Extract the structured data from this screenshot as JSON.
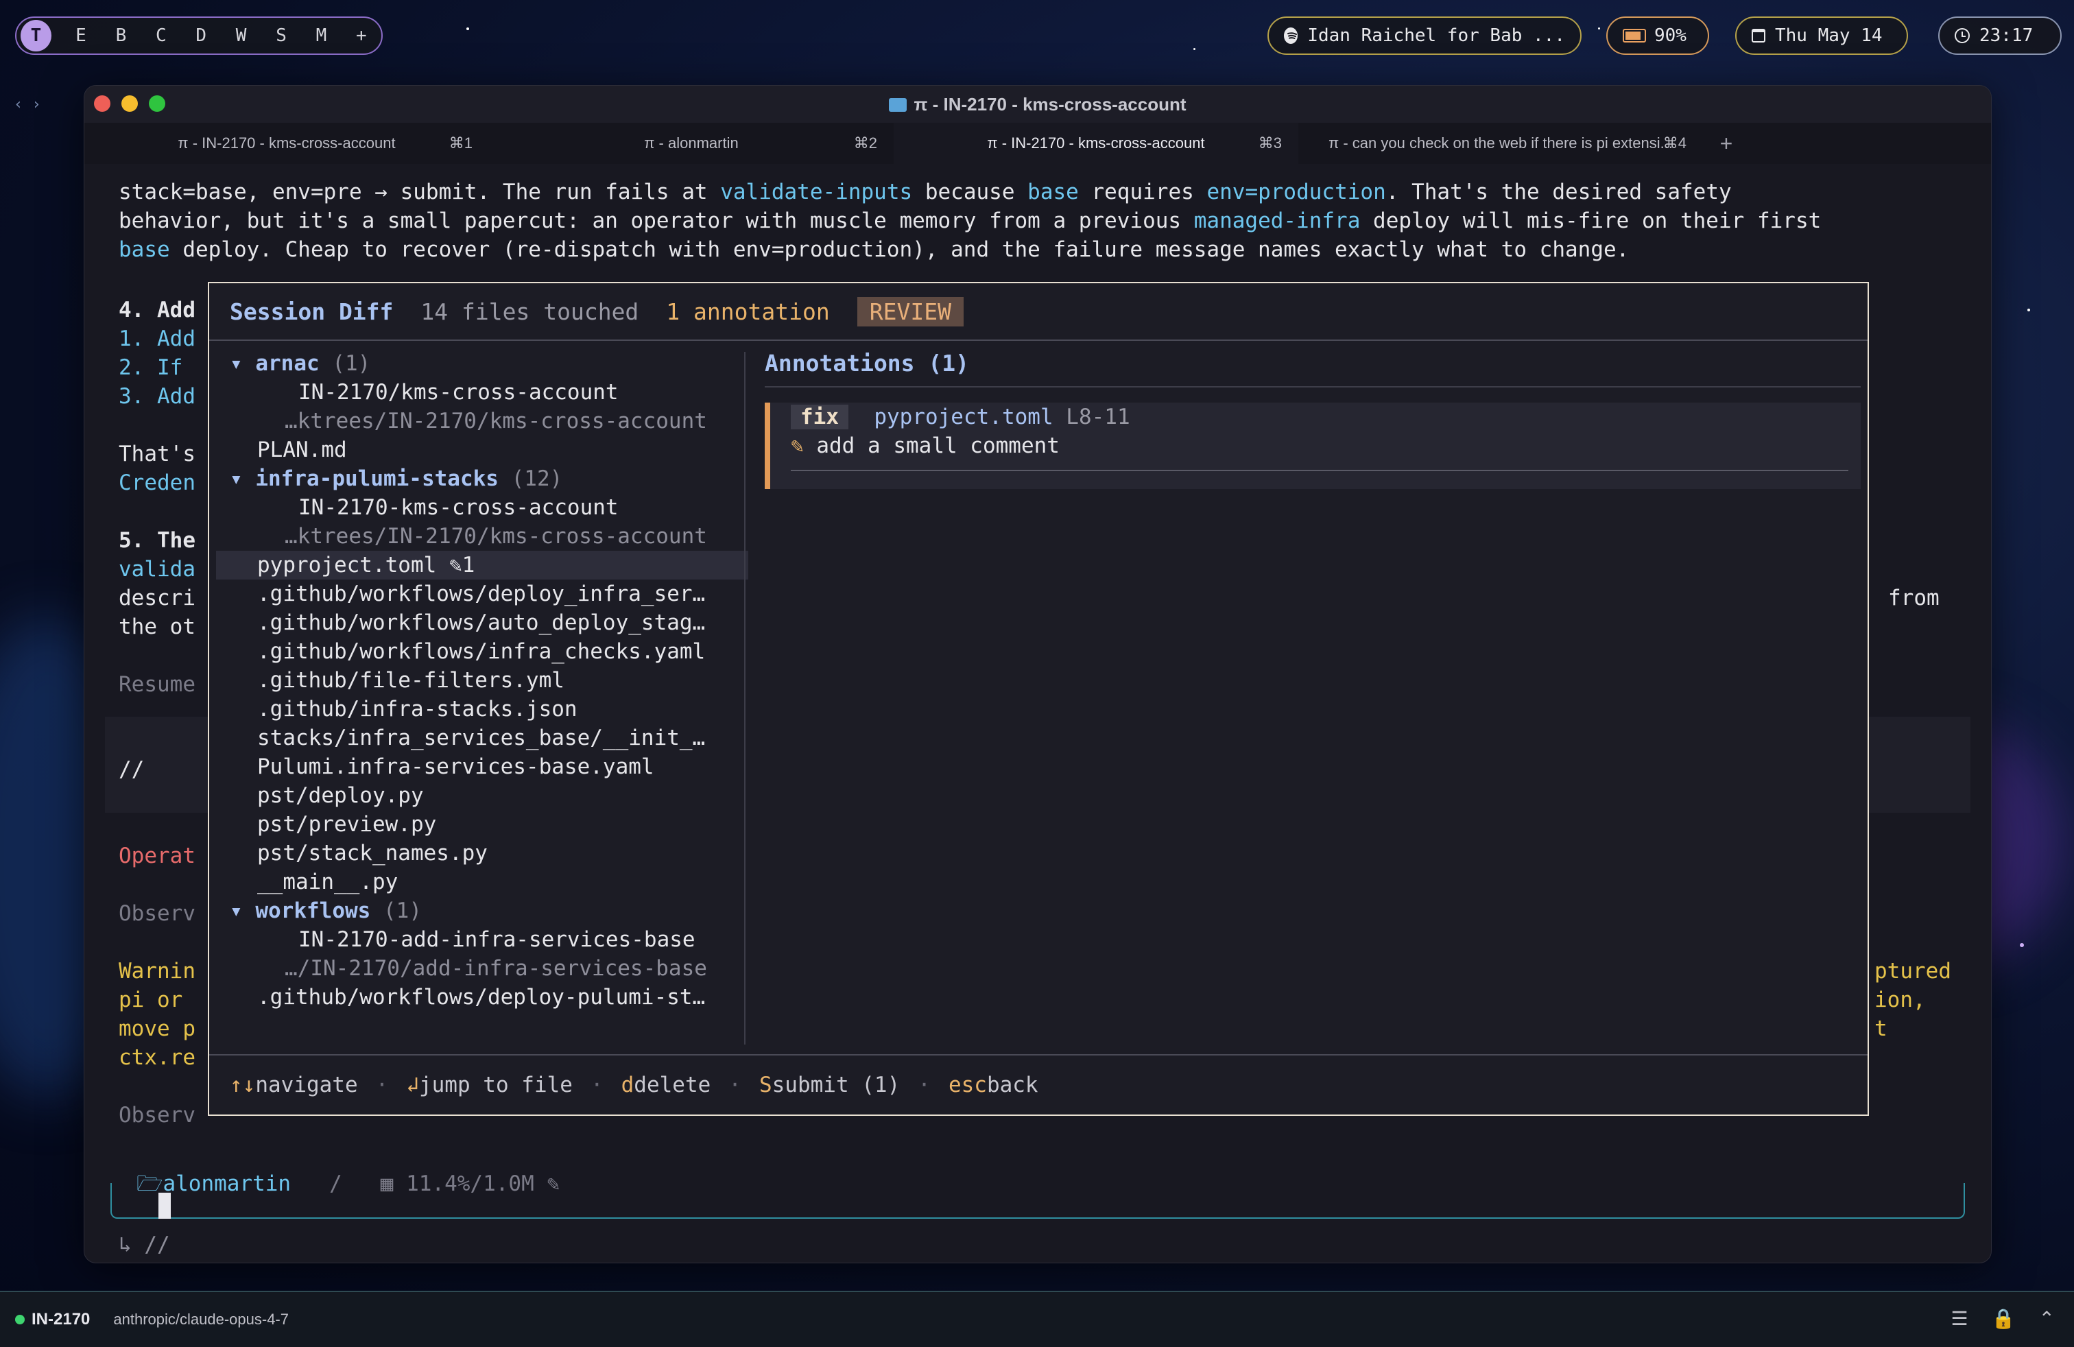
{
  "topbar": {
    "workspaces": [
      "T",
      "E",
      "B",
      "C",
      "D",
      "W",
      "S",
      "M",
      "+"
    ],
    "active_workspace": "T",
    "media": "Idan Raichel for Bab ...",
    "battery": "90%",
    "date": "Thu May 14",
    "time": "23:17"
  },
  "window": {
    "title": "π - IN-2170 - kms-cross-account",
    "tabs": [
      {
        "label": "π - IN-2170 - kms-cross-account",
        "shortcut": "⌘1"
      },
      {
        "label": "π - alonmartin",
        "shortcut": "⌘2"
      },
      {
        "label": "π - IN-2170 - kms-cross-account",
        "shortcut": "⌘3"
      },
      {
        "label": "π - can you check on the web if there is pi extensi...",
        "shortcut": "⌘4"
      }
    ],
    "active_tab": 2
  },
  "terminal": {
    "l1_a": "stack=base, env=pre → submit. The run fails at ",
    "l1_b": "validate-inputs",
    "l1_c": " because ",
    "l1_d": "base",
    "l1_e": " requires ",
    "l1_f": "env=production",
    "l1_g": ". That's the desired safety",
    "l2_a": "behavior, but it's a small papercut: an operator with muscle memory from a previous ",
    "l2_b": "managed-infra",
    "l2_c": " deploy will mis-fire on their first",
    "l3_a": "base",
    "l3_b": " deploy. Cheap to recover (re-dispatch with env=production), and the failure message names exactly what to change.",
    "l4": "4. Add",
    "l5": "1. Add",
    "l6": "2. If",
    "l7": "3. Add",
    "l8": "That's",
    "l9": "Creden",
    "l10": "5. The",
    "l11": "valida",
    "l12": "descri",
    "l13": "the ot",
    "l14": "Resume",
    "l15": "//",
    "l16": "Operat",
    "l17": "Observ",
    "l18": "Warnin",
    "l19": "pi or",
    "l20": "move p",
    "l21": "ctx.re",
    "l22": "Observ",
    "r_from": "from",
    "r_ptured": "ptured",
    "r_ion": "ion,",
    "r_t": "t"
  },
  "modal": {
    "title": "Session Diff",
    "files_touched": "14 files touched",
    "annotations_count": "1 annotation",
    "mode": "REVIEW",
    "tree": [
      {
        "kind": "group",
        "caret": "▾",
        "name": "arnac",
        "count": "(1)"
      },
      {
        "kind": "sub",
        "text": "IN-2170/kms-cross-account"
      },
      {
        "kind": "subdim",
        "text": "…ktrees/IN-2170/kms-cross-account"
      },
      {
        "kind": "file",
        "text": "PLAN.md"
      },
      {
        "kind": "group",
        "caret": "▾",
        "name": "infra-pulumi-stacks",
        "count": "(12)"
      },
      {
        "kind": "sub",
        "text": "IN-2170-kms-cross-account"
      },
      {
        "kind": "subdim",
        "text": "…ktrees/IN-2170/kms-cross-account"
      },
      {
        "kind": "filesel",
        "text": "pyproject.toml ✎1"
      },
      {
        "kind": "file",
        "text": ".github/workflows/deploy_infra_ser…"
      },
      {
        "kind": "file",
        "text": ".github/workflows/auto_deploy_stag…"
      },
      {
        "kind": "file",
        "text": ".github/workflows/infra_checks.yaml"
      },
      {
        "kind": "file",
        "text": ".github/file-filters.yml"
      },
      {
        "kind": "file",
        "text": ".github/infra-stacks.json"
      },
      {
        "kind": "file",
        "text": "stacks/infra_services_base/__init_…"
      },
      {
        "kind": "file",
        "text": "Pulumi.infra-services-base.yaml"
      },
      {
        "kind": "file",
        "text": "pst/deploy.py"
      },
      {
        "kind": "file",
        "text": "pst/preview.py"
      },
      {
        "kind": "file",
        "text": "pst/stack_names.py"
      },
      {
        "kind": "file",
        "text": "__main__.py"
      },
      {
        "kind": "group",
        "caret": "▾",
        "name": "workflows",
        "count": "(1)"
      },
      {
        "kind": "sub",
        "text": "IN-2170-add-infra-services-base"
      },
      {
        "kind": "subdim",
        "text": "…/IN-2170/add-infra-services-base"
      },
      {
        "kind": "file",
        "text": ".github/workflows/deploy-pulumi-st…"
      }
    ],
    "annotations_title": "Annotations (1)",
    "annotation": {
      "type": "fix",
      "file": "pyproject.toml",
      "lines": "L8-11",
      "comment": "add a small comment"
    },
    "footer": {
      "nav_key": "↑↓",
      "nav_label": "navigate",
      "jump_key": "↲",
      "jump_label": "jump to file",
      "delete_key": "d",
      "delete_label": "delete",
      "submit_key": "S",
      "submit_label": "submit (1)",
      "back_key": "esc",
      "back_label": "back"
    }
  },
  "prompt": {
    "path": "alonmartin",
    "sep": "/",
    "usage": "11.4%/1.0M",
    "subline": "↳ //"
  },
  "statusbar": {
    "branch": "IN-2170",
    "model": "anthropic/claude-opus-4-7"
  },
  "colors": {
    "accent_blue": "#6ec6ee",
    "accent_orange": "#e9b36a",
    "accent_purple": "#b99ce8",
    "status_green": "#3ed46f"
  }
}
